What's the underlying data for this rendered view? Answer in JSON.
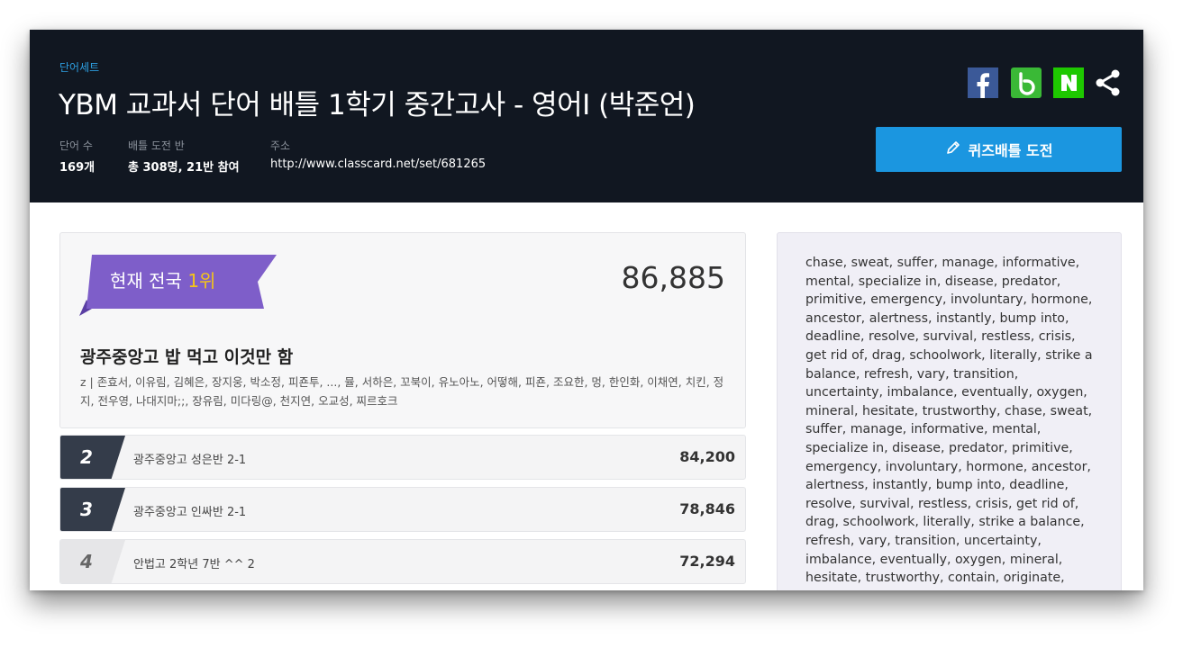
{
  "header": {
    "set_label": "단어세트",
    "title": "YBM 교과서 단어 배틀 1학기 중간고사 - 영어I (박준언)",
    "meta": [
      {
        "key": "단어 수",
        "value": "169개"
      },
      {
        "key": "배틀 도전 반",
        "value": "총 308명, 21반 참여"
      },
      {
        "key": "주소",
        "value": "http://www.classcard.net/set/681265"
      }
    ],
    "share_icons": [
      "facebook-icon",
      "band-icon",
      "naver-icon",
      "share-icon"
    ],
    "quiz_button_label": "퀴즈배틀 도전",
    "quiz_button_icon": "pencil-icon"
  },
  "ranking": {
    "top": {
      "badge_prefix": "현재 전국 ",
      "badge_rank": "1위",
      "score": "86,885",
      "team": "광주중앙고 밥 먹고 이것만 함",
      "members": "z | 존효서, 이유림, 김혜은, 장지웅, 박소정, 피죤투, ..., 뮬, 서하은, 꼬북이, 유노아노, 어떻해, 피죤, 조요한, 멍, 한인화, 이채연, 치킨, 정지, 전우영, 나대지마;;, 장유림, 미다링@, 천지연, 오교성, 찌르호크"
    },
    "rows": [
      {
        "rank": "2",
        "team": "광주중앙고 성은반 2-1",
        "score": "84,200"
      },
      {
        "rank": "3",
        "team": "광주중앙고 인싸반 2-1",
        "score": "78,846"
      },
      {
        "rank": "4",
        "team": "안법고 2학년 7반 ^^ 2",
        "score": "72,294"
      }
    ]
  },
  "words_panel": {
    "text": "chase, sweat, suffer, manage, informative, mental, specialize in, disease, predator, primitive, emergency, involuntary, hormone, ancestor, alertness, instantly, bump into, deadline, resolve, survival, restless, crisis, get rid of, drag, schoolwork, literally, strike a balance, refresh, vary, transition, uncertainty, imbalance, eventually, oxygen, mineral, hesitate, trustworthy, chase, sweat, suffer, manage, informative, mental, specialize in, disease, predator, primitive, emergency, involuntary, hormone, ancestor, alertness, instantly, bump into, deadline, resolve, survival, restless, crisis, get rid of, drag, schoolwork, literally, strike a balance, refresh, vary, transition, uncertainty, imbalance, eventually, oxygen, mineral, hesitate, trustworthy, contain, originate,"
  },
  "colors": {
    "header_bg": "#111721",
    "accent_blue": "#1b96e0",
    "ribbon_purple": "#7e5ec9",
    "rank_gold": "#f5c518",
    "dark_rank_bg": "#343c4a",
    "words_bg": "#f0eff6"
  }
}
